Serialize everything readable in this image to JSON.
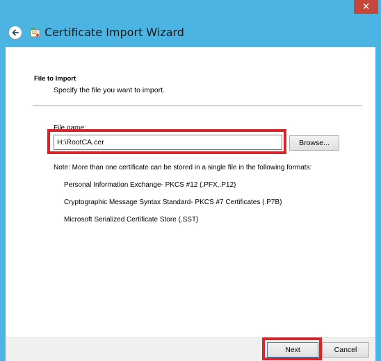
{
  "window": {
    "title": "Certificate Import Wizard",
    "close_glyph": "✕"
  },
  "section": {
    "title": "File to Import",
    "description": "Specify the file you want to import."
  },
  "file": {
    "label_first": "F",
    "label_rest": "ile name:",
    "value": "H:\\RootCA.cer",
    "browse_label": "Browse..."
  },
  "note": "Note:  More than one certificate can be stored in a single file in the following formats:",
  "formats": [
    "Personal Information Exchange- PKCS #12 (.PFX,.P12)",
    "Cryptographic Message Syntax Standard- PKCS #7 Certificates (.P7B)",
    "Microsoft Serialized Certificate Store (.SST)"
  ],
  "footer": {
    "next_label": "Next",
    "cancel_label": "Cancel"
  },
  "colors": {
    "titlebar": "#4cb4e2",
    "highlight": "#d6262b",
    "close": "#c7463b"
  },
  "icons": [
    "close-icon",
    "back-arrow-icon",
    "certificate-wizard-icon"
  ]
}
